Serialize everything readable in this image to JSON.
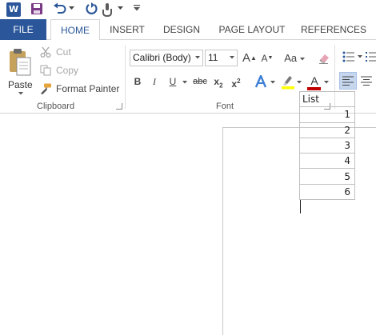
{
  "qat": {
    "logo_letter": "W",
    "icons": [
      "word-logo",
      "save-icon",
      "undo-icon",
      "redo-icon",
      "touch-mode-icon",
      "customize-qat-icon"
    ]
  },
  "tabs": [
    {
      "label": "FILE"
    },
    {
      "label": "HOME"
    },
    {
      "label": "INSERT"
    },
    {
      "label": "DESIGN"
    },
    {
      "label": "PAGE LAYOUT"
    },
    {
      "label": "REFERENCES"
    }
  ],
  "clipboard": {
    "paste_label": "Paste",
    "cut_label": "Cut",
    "copy_label": "Copy",
    "format_painter_label": "Format Painter",
    "group_label": "Clipboard"
  },
  "font": {
    "font_name": "Calibri (Body)",
    "font_size": "11",
    "case_label": "Aa",
    "group_label": "Font",
    "bold_label": "B",
    "italic_label": "I",
    "underline_label": "U",
    "strike_label": "abc",
    "sub_label": "x",
    "sub_index": "2",
    "sup_label": "x",
    "sup_index": "2",
    "grow_label": "A",
    "shrink_label": "A",
    "color_letter": "A"
  },
  "colors": {
    "accent": "#2b579a",
    "highlight": "#ffff00",
    "font_color": "#c00000"
  },
  "document": {
    "table": {
      "header": "List",
      "values": [
        "1",
        "2",
        "3",
        "4",
        "5",
        "6"
      ]
    }
  }
}
